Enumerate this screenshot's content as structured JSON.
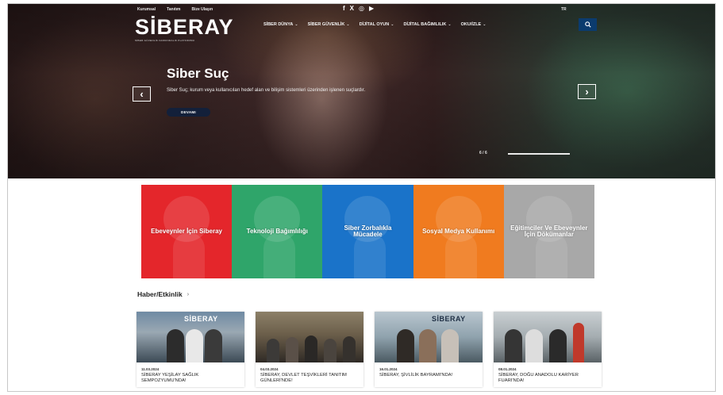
{
  "topbar": {
    "links": [
      "Kurumsal",
      "Tanıtım",
      "Bize Ulaşın"
    ],
    "lang": "TR"
  },
  "social": {
    "facebook": "f",
    "x": "X",
    "instagram": "◎",
    "youtube": "▶"
  },
  "logo": {
    "text": "SİBERAY",
    "sub": "SİBER GÜVENLİK FARKINDALIK PLATFORMU"
  },
  "nav": {
    "items": [
      {
        "label": "SİBER DÜNYA"
      },
      {
        "label": "SİBER GÜVENLİK"
      },
      {
        "label": "DİJİTAL OYUN"
      },
      {
        "label": "DİJİTAL BAĞIMLILIK"
      },
      {
        "label": "OKU/İZLE"
      }
    ]
  },
  "hero": {
    "title": "Siber Suç",
    "description": "Siber Suç; kurum veya kullanıcıları hedef alan ve bilişim sistemleri üzerinden işlenen suçlardır.",
    "button": "DEVAMI",
    "counter": "6 / 6",
    "progress": 1.0
  },
  "tiles": [
    {
      "label": "Ebeveynler İçin Siberay",
      "color": "#e4262b"
    },
    {
      "label": "Teknoloji Bağımlılığı",
      "color": "#2fa56a"
    },
    {
      "label": "Siber Zorbalıkla Mücadele",
      "color": "#1a73c9"
    },
    {
      "label": "Sosyal Medya Kullanımı",
      "color": "#f07b1f"
    },
    {
      "label": "Eğitimciler Ve Ebeveynler İçin Dökümanlar",
      "color": "#a8a8a8"
    }
  ],
  "news": {
    "title": "Haber/Etkinlik",
    "cards": [
      {
        "date": "11.03.2024",
        "title": "SİBERAY YEŞİLAY SAĞLIK SEMPOZYUMU'NDA!",
        "banner": "SİBERAY"
      },
      {
        "date": "04.03.2024",
        "title": "SİBERAY, DEVLET TEŞVİKLERİ TANITIM GÜNLERİ'NDE!",
        "banner": ""
      },
      {
        "date": "16.01.2024",
        "title": "SİBERAY, ŞİVLİLİK BAYRAMI'NDA!",
        "banner": "SİBERAY"
      },
      {
        "date": "08.01.2024",
        "title": "SİBERAY, DOĞU ANADOLU KARİYER FUARI'NDA!",
        "banner": ""
      }
    ]
  }
}
